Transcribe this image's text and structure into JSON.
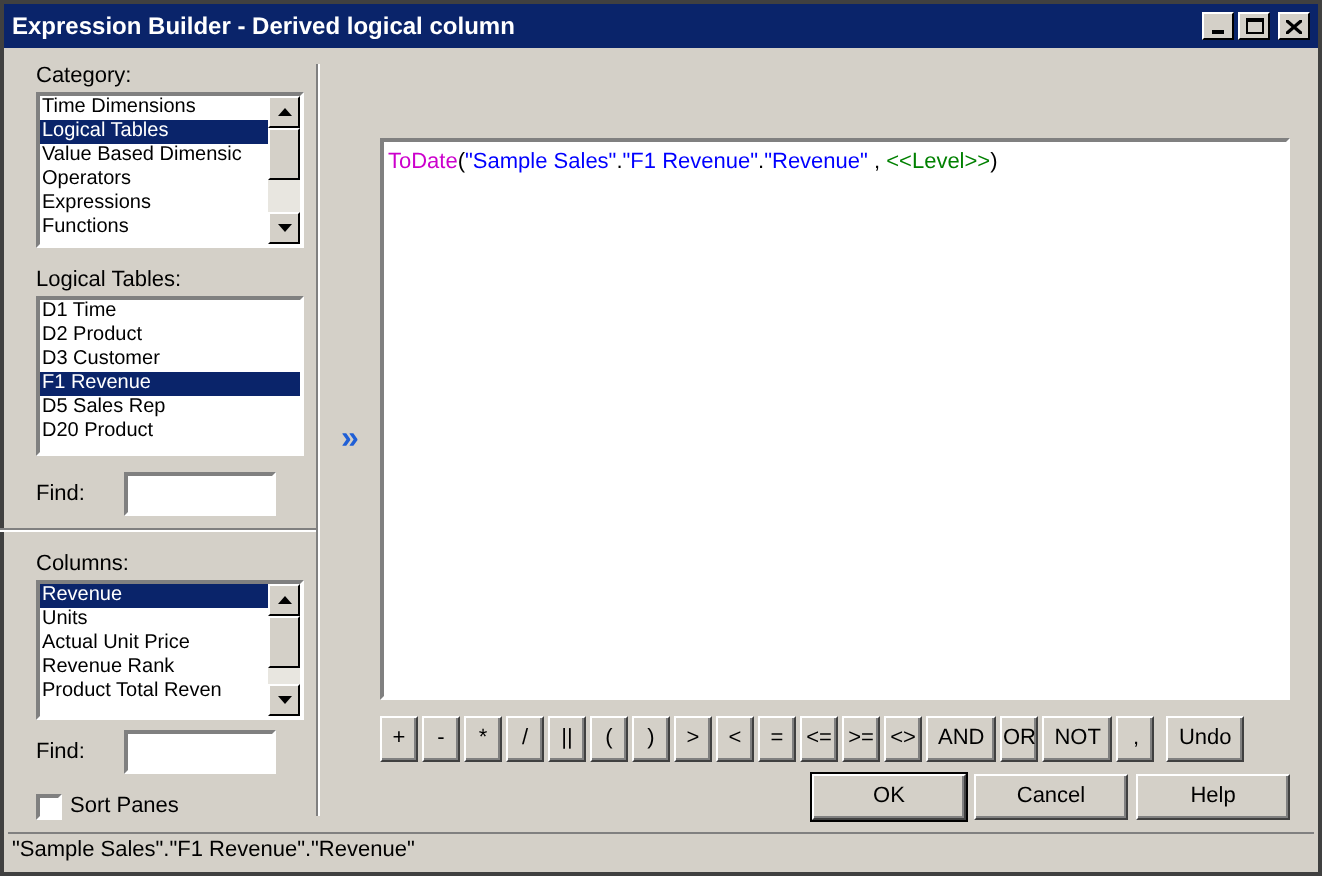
{
  "window": {
    "title": "Expression Builder - Derived logical column"
  },
  "category": {
    "label": "Category:",
    "items": [
      {
        "label": "Time Dimensions",
        "selected": false
      },
      {
        "label": "Logical Tables",
        "selected": true
      },
      {
        "label": "Value Based Dimensic",
        "selected": false
      },
      {
        "label": "Operators",
        "selected": false
      },
      {
        "label": "Expressions",
        "selected": false
      },
      {
        "label": "Functions",
        "selected": false
      }
    ]
  },
  "logical_tables": {
    "label": "Logical Tables:",
    "items": [
      {
        "label": "D1 Time",
        "selected": false
      },
      {
        "label": "D2 Product",
        "selected": false
      },
      {
        "label": "D3 Customer",
        "selected": false
      },
      {
        "label": "F1 Revenue",
        "selected": true
      },
      {
        "label": "D5 Sales Rep",
        "selected": false
      },
      {
        "label": "D20 Product",
        "selected": false
      }
    ],
    "find_label": "Find:"
  },
  "columns": {
    "label": "Columns:",
    "items": [
      {
        "label": "Revenue",
        "selected": true
      },
      {
        "label": "Units",
        "selected": false
      },
      {
        "label": "Actual Unit Price",
        "selected": false
      },
      {
        "label": "Revenue Rank",
        "selected": false
      },
      {
        "label": "Product Total Reven",
        "selected": false
      }
    ],
    "find_label": "Find:"
  },
  "sort_panes": {
    "label": "Sort Panes",
    "checked": false
  },
  "insert_arrow": "»",
  "expression": [
    {
      "kind": "function",
      "text": "ToDate"
    },
    {
      "kind": "plain",
      "text": "("
    },
    {
      "kind": "string",
      "text": "\"Sample Sales\""
    },
    {
      "kind": "plain",
      "text": "."
    },
    {
      "kind": "string",
      "text": "\"F1 Revenue\""
    },
    {
      "kind": "plain",
      "text": "."
    },
    {
      "kind": "string",
      "text": "\"Revenue\""
    },
    {
      "kind": "plain",
      "text": " , "
    },
    {
      "kind": "placeholder",
      "text": "<<Level>>"
    },
    {
      "kind": "plain",
      "text": ")"
    }
  ],
  "operators": [
    "+",
    "-",
    "*",
    "/",
    "||",
    "(",
    ")",
    ">",
    "<",
    "=",
    "<=",
    ">=",
    "<>",
    "AND",
    "OR",
    "NOT",
    ",",
    "Undo"
  ],
  "buttons": [
    {
      "label": "OK",
      "default": true
    },
    {
      "label": "Cancel",
      "default": false
    },
    {
      "label": "Help",
      "default": false
    }
  ],
  "status_bar": "\"Sample Sales\".\"F1 Revenue\".\"Revenue\""
}
